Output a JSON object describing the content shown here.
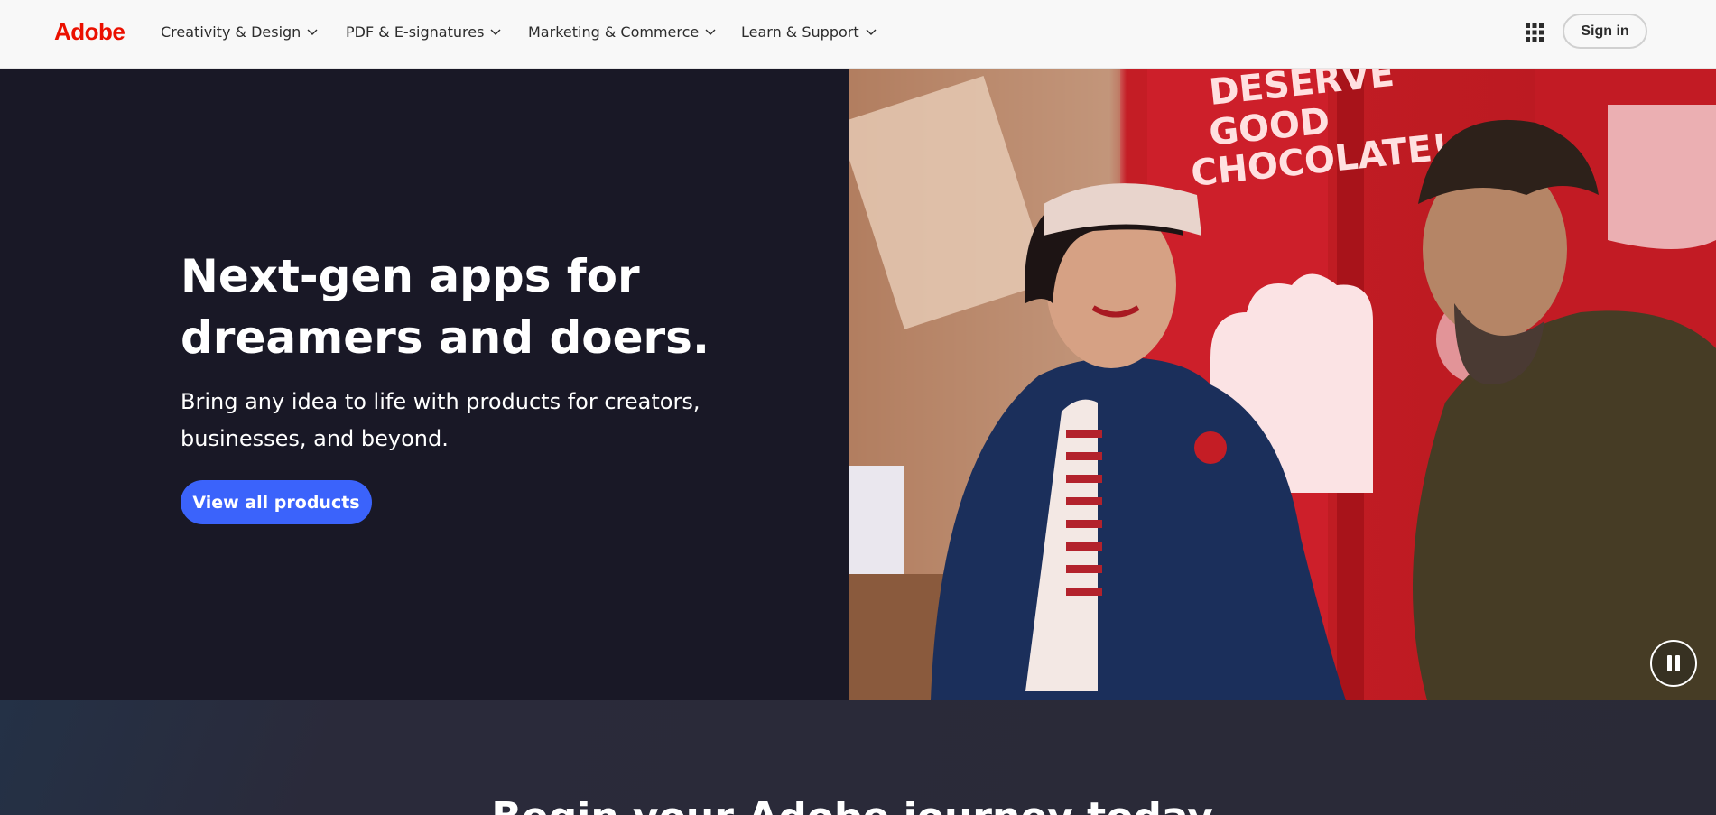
{
  "brand": {
    "logo_text": "Adobe",
    "logo_color": "#eb1000"
  },
  "nav": {
    "items": [
      {
        "label": "Creativity & Design"
      },
      {
        "label": "PDF & E-signatures"
      },
      {
        "label": "Marketing & Commerce"
      },
      {
        "label": "Learn & Support"
      }
    ],
    "apps_icon": "apps-grid-icon",
    "signin_label": "Sign in"
  },
  "hero": {
    "headline": "Next-gen apps for dreamers and doers.",
    "subhead": "Bring any idea to life with products for creators, businesses, and beyond.",
    "cta_label": "View all products",
    "cta_color": "#3b63fb",
    "media_alt": "video-still",
    "pause_icon": "pause-icon"
  },
  "section2": {
    "title": "Begin your Adobe journey today."
  }
}
